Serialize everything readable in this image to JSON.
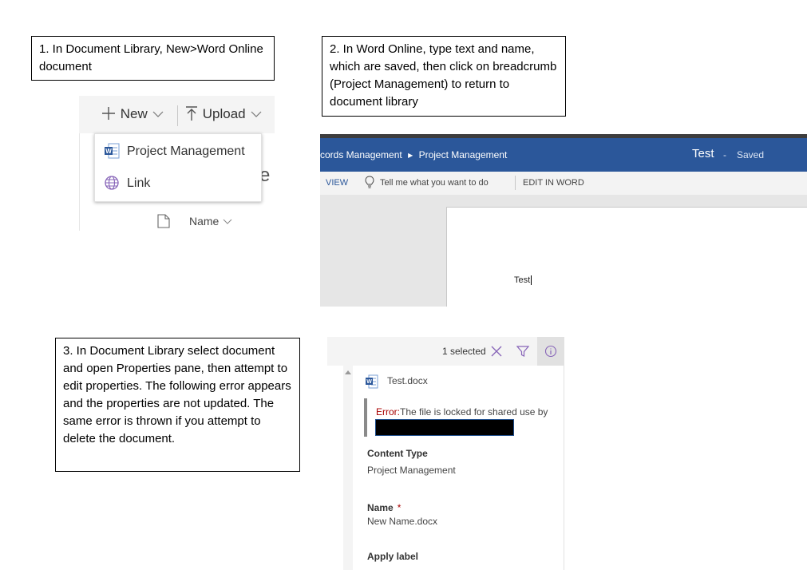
{
  "callouts": {
    "step1": "1. In Document Library, New>Word Online document",
    "step2": "2. In Word Online, type text and name, which are saved, then click on breadcrumb (Project Management) to return to document library",
    "step3": "3. In Document Library select document and open Properties pane, then attempt to edit properties. The following error appears and the properties are not updated. The same error is thrown if you attempt to delete the document."
  },
  "library_toolbar": {
    "new_label": "New",
    "upload_label": "Upload",
    "menu_items": [
      {
        "label": "Project Management",
        "icon": "word-document-icon"
      },
      {
        "label": "Link",
        "icon": "globe-icon"
      }
    ],
    "column_name": "Name",
    "partial_text": "e"
  },
  "word_online": {
    "breadcrumb_parent": "cords Management",
    "breadcrumb_current": "Project Management",
    "doc_title": "Test",
    "title_separator": "-",
    "save_status": "Saved",
    "ribbon": {
      "view_tab": "VIEW",
      "tell_me": "Tell me what you want to do",
      "edit_in_word": "EDIT IN WORD"
    },
    "body_text": "Test",
    "colors": {
      "title_bar": "#2b579a"
    }
  },
  "properties_pane": {
    "selected_count": "1 selected",
    "file_name": "Test.docx",
    "error_prefix": "Error:",
    "error_text": "The file is locked for shared use by",
    "fields": [
      {
        "label": "Content Type",
        "value": "Project Management"
      },
      {
        "label": "Name",
        "required_marker": "*",
        "value": "New Name.docx"
      },
      {
        "label": "Apply label"
      }
    ],
    "colors": {
      "error": "#a80000",
      "accent_purple": "#8764b8"
    }
  }
}
